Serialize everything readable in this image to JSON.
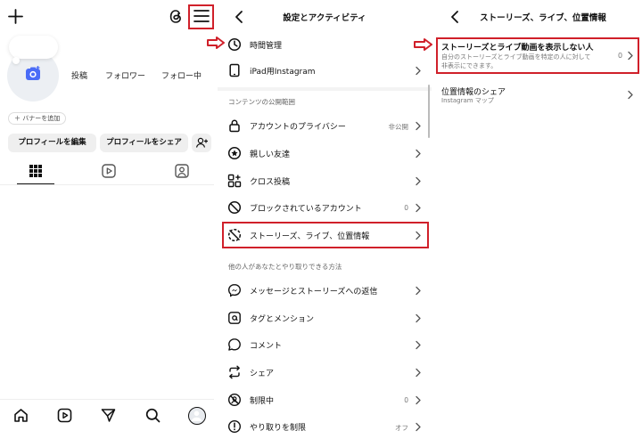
{
  "panel1": {
    "stats": [
      "投稿",
      "フォロワー",
      "フォロー中"
    ],
    "banner_add": "＋ バナーを追加",
    "edit_profile": "プロフィールを編集",
    "share_profile": "プロフィールをシェア"
  },
  "panel2": {
    "title": "設定とアクティビティ",
    "rows_top": [
      {
        "label": "時間管理",
        "icon": "clock-icon",
        "value": ""
      },
      {
        "label": "iPad用Instagram",
        "icon": "ipad-icon",
        "value": ""
      }
    ],
    "section1": "コンテンツの公開範囲",
    "rows_mid": [
      {
        "label": "アカウントのプライバシー",
        "icon": "lock-icon",
        "value": "非公開"
      },
      {
        "label": "親しい友達",
        "icon": "star-circle-icon",
        "value": ""
      },
      {
        "label": "クロス投稿",
        "icon": "cross-post-icon",
        "value": ""
      },
      {
        "label": "ブロックされているアカウント",
        "icon": "block-icon",
        "value": "0"
      },
      {
        "label": "ストーリーズ、ライブ、位置情報",
        "icon": "story-off-icon",
        "value": ""
      }
    ],
    "section2": "他の人があなたとやり取りできる方法",
    "rows_bottom": [
      {
        "label": "メッセージとストーリーズへの返信",
        "icon": "messenger-icon",
        "value": ""
      },
      {
        "label": "タグとメンション",
        "icon": "at-sign-icon",
        "value": ""
      },
      {
        "label": "コメント",
        "icon": "comment-icon",
        "value": ""
      },
      {
        "label": "シェア",
        "icon": "share-icon",
        "value": ""
      },
      {
        "label": "制限中",
        "icon": "restricted-icon",
        "value": "0"
      },
      {
        "label": "やり取りを制限",
        "icon": "limit-icon",
        "value": "オフ"
      }
    ]
  },
  "panel3": {
    "title": "ストーリーズ、ライブ、位置情報",
    "item1_title": "ストーリーズとライブ動画を表示しない人",
    "item1_sub1": "自分のストーリーズとライブ動画を特定の人に対して",
    "item1_sub2": "非表示にできます。",
    "item1_value": "0",
    "item2_title": "位置情報のシェア",
    "item2_sub": "Instagram マップ"
  },
  "colors": {
    "highlight": "#d0202a",
    "accent": "#4a6cf7"
  }
}
